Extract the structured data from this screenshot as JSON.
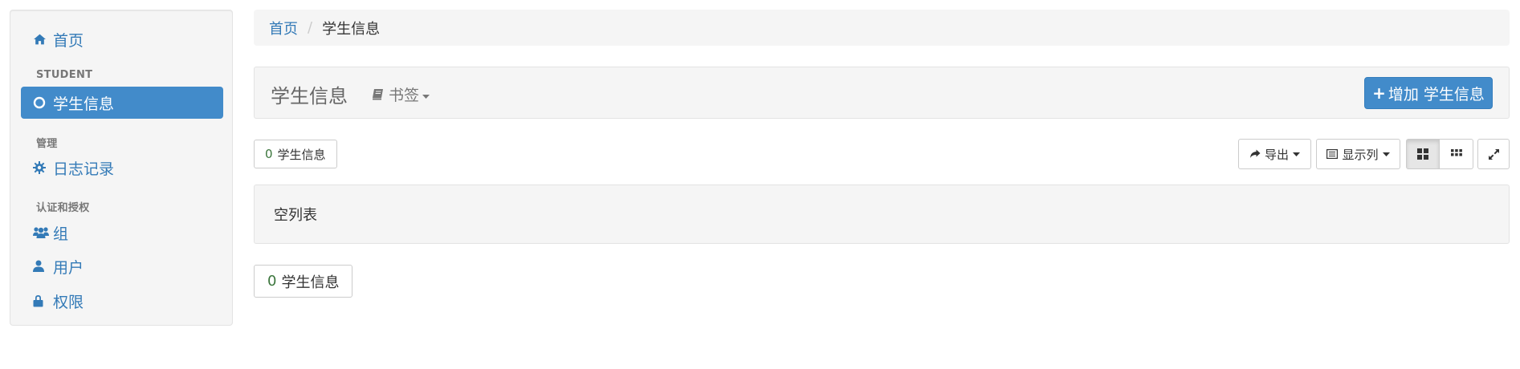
{
  "sidebar": {
    "home": {
      "label": "首页",
      "icon": "home-icon"
    },
    "student_header": "STUDENT",
    "student_item": {
      "label": "学生信息",
      "icon": "circle-icon",
      "active": true
    },
    "admin_header": "管理",
    "log_item": {
      "label": "日志记录",
      "icon": "gear-icon"
    },
    "auth_header": "认证和授权",
    "group_item": {
      "label": "组",
      "icon": "group-icon"
    },
    "user_item": {
      "label": "用户",
      "icon": "user-icon"
    },
    "perm_item": {
      "label": "权限",
      "icon": "lock-icon"
    }
  },
  "breadcrumb": {
    "home": "首页",
    "separator": "/",
    "current": "学生信息"
  },
  "header": {
    "title": "学生信息",
    "bookmark_label": "书签",
    "add_button": {
      "plus": "+",
      "label": "增加 学生信息"
    }
  },
  "toolbar": {
    "count_num": "0",
    "count_label": "学生信息",
    "export_label": "导出",
    "columns_label": "显示列"
  },
  "empty_text": "空列表",
  "footer_count": {
    "num": "0",
    "label": "学生信息"
  },
  "colors": {
    "accent": "#428bca",
    "link": "#337ab7",
    "panel": "#f5f5f5",
    "count_number": "#3c763d"
  }
}
